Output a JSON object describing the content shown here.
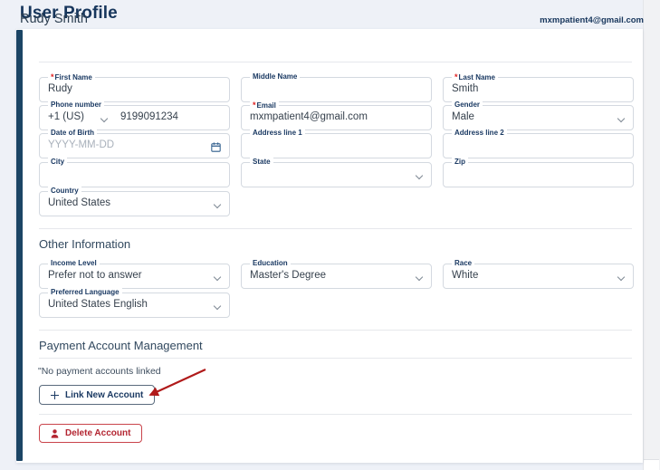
{
  "header": {
    "title": "User Profile"
  },
  "card": {
    "user_name": "Rudy Smith",
    "account_email": "mxmpatient4@gmail.com"
  },
  "fields": {
    "first_name": {
      "label": "First Name",
      "required": true,
      "value": "Rudy",
      "type": "text"
    },
    "middle_name": {
      "label": "Middle Name",
      "required": false,
      "value": "",
      "type": "text"
    },
    "last_name": {
      "label": "Last Name",
      "required": true,
      "value": "Smith",
      "type": "text"
    },
    "phone_number": {
      "label": "Phone number",
      "required": false,
      "country_code": "+1 (US)",
      "value": "9199091234",
      "type": "phone"
    },
    "email": {
      "label": "Email",
      "required": true,
      "value": "mxmpatient4@gmail.com",
      "type": "text"
    },
    "gender": {
      "label": "Gender",
      "required": false,
      "value": "Male",
      "type": "select"
    },
    "date_of_birth": {
      "label": "Date of Birth",
      "required": false,
      "value": "",
      "placeholder": "YYYY-MM-DD",
      "type": "date"
    },
    "address_line_1": {
      "label": "Address line 1",
      "required": false,
      "value": "",
      "type": "text"
    },
    "address_line_2": {
      "label": "Address line 2",
      "required": false,
      "value": "",
      "type": "text"
    },
    "city": {
      "label": "City",
      "required": false,
      "value": "",
      "type": "text"
    },
    "state": {
      "label": "State",
      "required": false,
      "value": "",
      "type": "select"
    },
    "zip": {
      "label": "Zip",
      "required": false,
      "value": "",
      "type": "text"
    },
    "country": {
      "label": "Country",
      "required": false,
      "value": "United States",
      "type": "select"
    },
    "income_level": {
      "label": "Income Level",
      "required": false,
      "value": "Prefer not to answer",
      "type": "select"
    },
    "education": {
      "label": "Education",
      "required": false,
      "value": "Master's Degree",
      "type": "select"
    },
    "race": {
      "label": "Race",
      "required": false,
      "value": "White",
      "type": "select"
    },
    "preferred_language": {
      "label": "Preferred Language",
      "required": false,
      "value": "United States English",
      "type": "select"
    }
  },
  "sections": {
    "other_information": "Other Information",
    "payment_account_management": "Payment Account Management"
  },
  "payment": {
    "empty_message": "\"No payment accounts linked",
    "link_button": "Link New Account"
  },
  "danger": {
    "delete_button": "Delete Account"
  },
  "colors": {
    "accent_bar": "#1b4565",
    "title": "#17365c",
    "page_background": "#eef1f7",
    "card_background": "#ffffff",
    "required_marker": "#e02020",
    "danger": "#b32531",
    "annotation_arrow": "#b01a1a"
  }
}
